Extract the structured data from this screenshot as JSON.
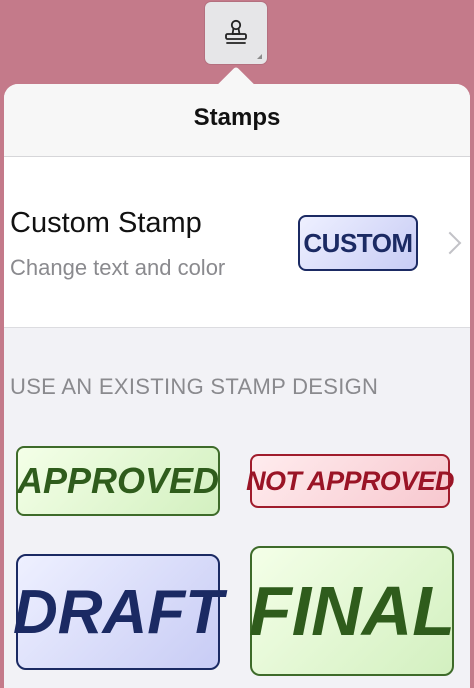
{
  "toolbar": {
    "stamp_tool_icon": "stamp-icon"
  },
  "popover": {
    "title": "Stamps",
    "custom_stamp": {
      "title": "Custom Stamp",
      "subtitle": "Change text and color",
      "preview_label": "CUSTOM",
      "chevron_icon": "chevron-right-icon"
    },
    "section_header": "USE AN EXISTING STAMP DESIGN",
    "stamps": [
      {
        "label": "APPROVED",
        "color": "#2f5c1c"
      },
      {
        "label": "NOT APPROVED",
        "color": "#9a1426"
      },
      {
        "label": "DRAFT",
        "color": "#1b2a63"
      },
      {
        "label": "FINAL",
        "color": "#2f5c1c"
      }
    ]
  },
  "colors": {
    "backdrop": "#c47a8a",
    "popover_background": "#f2f2f6",
    "secondary_text": "#8a8a8e"
  }
}
